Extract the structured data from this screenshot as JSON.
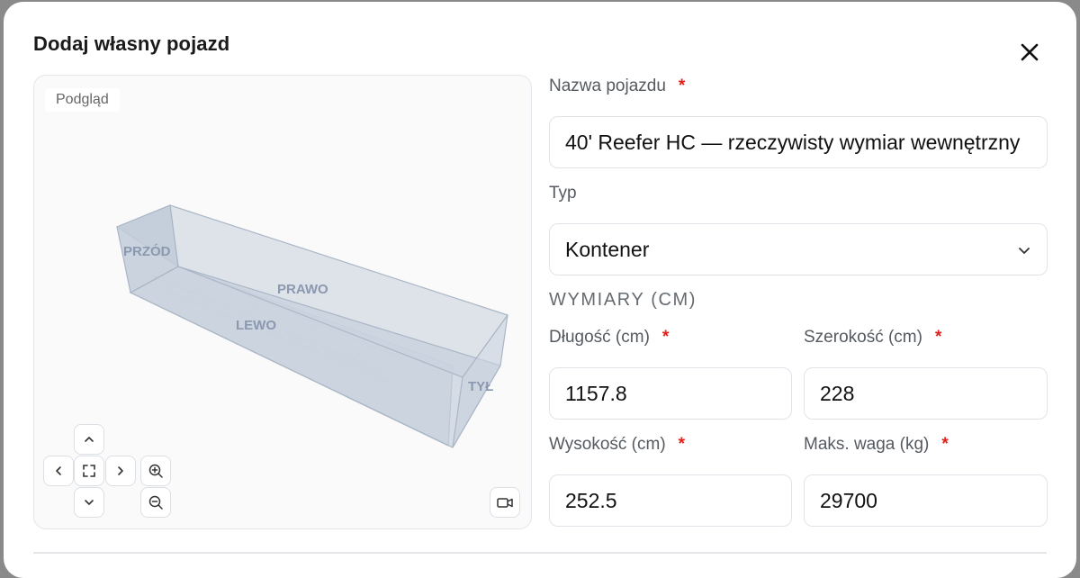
{
  "dialog": {
    "title": "Dodaj własny pojazd"
  },
  "preview": {
    "label": "Podgląd",
    "face_labels": {
      "front": "PRZÓD",
      "right": "PRAWO",
      "left": "LEWO",
      "back": "TYŁ"
    }
  },
  "form": {
    "name_label": "Nazwa pojazdu",
    "name_value": "40' Reefer HC — rzeczywisty wymiar wewnętrzny",
    "type_label": "Typ",
    "type_value": "Kontener",
    "dimensions_section": "WYMIARY (CM)",
    "length_label": "Długość (cm)",
    "length_value": "1157.8",
    "width_label": "Szerokość (cm)",
    "width_value": "228",
    "height_label": "Wysokość (cm)",
    "height_value": "252.5",
    "weight_label": "Maks. waga (kg)",
    "weight_value": "29700",
    "required_mark": "*"
  },
  "colors": {
    "required": "#e0201a",
    "box_fill": "#c9d2de",
    "box_stroke": "#aab6c6",
    "box_label": "#8a98b0"
  }
}
